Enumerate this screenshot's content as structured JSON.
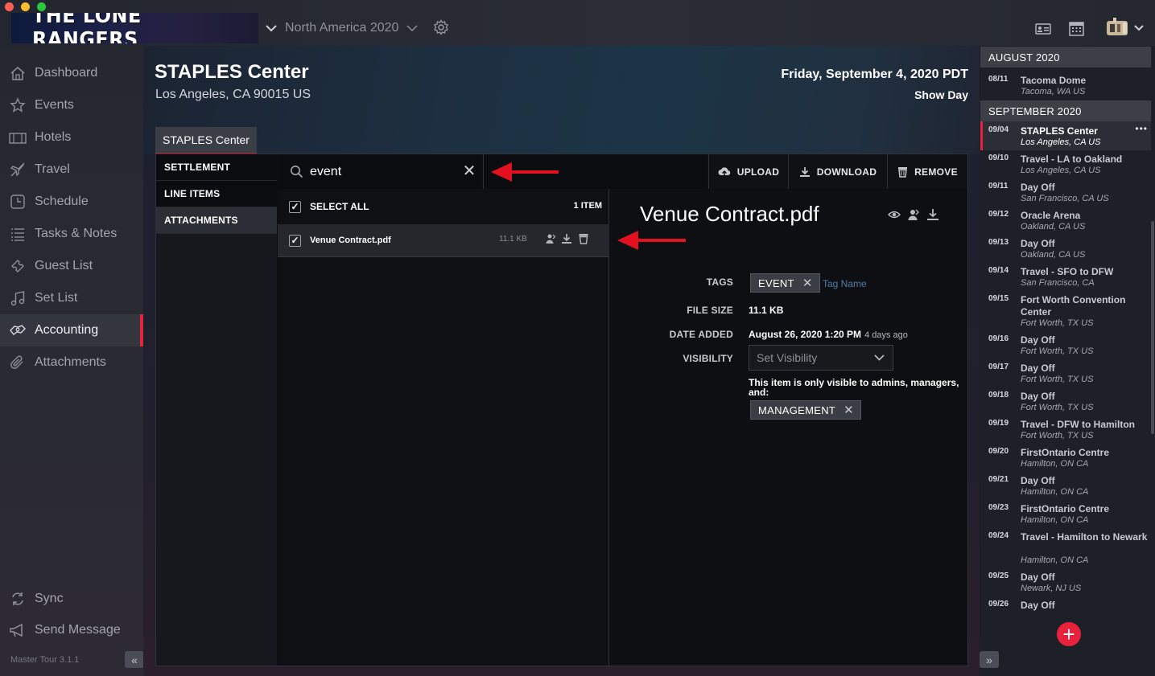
{
  "window": {
    "traffic_colors": [
      "#fe5f57",
      "#febc2e",
      "#28c840"
    ]
  },
  "header": {
    "logo_text": "THE LONE RANGERS",
    "tour_name": "North America 2020"
  },
  "sidebar": {
    "items": [
      {
        "label": "Dashboard",
        "icon": "house-icon"
      },
      {
        "label": "Events",
        "icon": "star-icon"
      },
      {
        "label": "Hotels",
        "icon": "hotel-icon"
      },
      {
        "label": "Travel",
        "icon": "plane-icon"
      },
      {
        "label": "Schedule",
        "icon": "clock-icon"
      },
      {
        "label": "Tasks & Notes",
        "icon": "list-icon"
      },
      {
        "label": "Guest List",
        "icon": "ticket-icon"
      },
      {
        "label": "Set List",
        "icon": "music-note-icon"
      },
      {
        "label": "Accounting",
        "icon": "money-icon",
        "active": true
      },
      {
        "label": "Attachments",
        "icon": "paperclip-icon"
      }
    ],
    "sync_label": "Sync",
    "send_message_label": "Send Message",
    "version": "Master Tour 3.1.1"
  },
  "venue": {
    "name": "STAPLES Center",
    "address": "Los Angeles, CA 90015 US",
    "date": "Friday, September 4, 2020 PDT",
    "day_type": "Show Day",
    "tab_label": "STAPLES Center"
  },
  "subnav": {
    "items": [
      "SETTLEMENT",
      "LINE ITEMS",
      "ATTACHMENTS"
    ],
    "active": "ATTACHMENTS"
  },
  "search": {
    "value": "event"
  },
  "toolbar": {
    "upload_label": "UPLOAD",
    "download_label": "DOWNLOAD",
    "remove_label": "REMOVE"
  },
  "file_list": {
    "select_all_label": "SELECT ALL",
    "count_label": "1 ITEM",
    "files": [
      {
        "name": "Venue Contract.pdf",
        "size": "11.1 KB",
        "checked": true
      }
    ]
  },
  "detail": {
    "title": "Venue Contract.pdf",
    "tags_label": "TAGS",
    "tags": [
      "EVENT"
    ],
    "tag_placeholder": "Tag Name",
    "file_size_label": "FILE SIZE",
    "file_size": "11.1 KB",
    "date_added_label": "DATE ADDED",
    "date_added": "August 26, 2020 1:20 PM",
    "date_added_relative": "4 days ago",
    "visibility_label": "VISIBILITY",
    "visibility_placeholder": "Set Visibility",
    "visibility_note": "This item is only visible to admins, managers, and:",
    "visibility_groups": [
      "MANAGEMENT"
    ]
  },
  "schedule": {
    "months": [
      {
        "label": "AUGUST 2020",
        "items": [
          {
            "date": "08/11",
            "title": "Tacoma Dome",
            "sub": "Tacoma, WA US"
          }
        ]
      },
      {
        "label": "SEPTEMBER 2020",
        "items": [
          {
            "date": "09/04",
            "title": "STAPLES Center",
            "sub": "Los Angeles, CA US",
            "active": true
          },
          {
            "date": "09/10",
            "title": "Travel - LA to Oakland",
            "sub": "Los Angeles, CA US"
          },
          {
            "date": "09/11",
            "title": "Day Off",
            "sub": "San Francisco, CA US"
          },
          {
            "date": "09/12",
            "title": "Oracle Arena",
            "sub": "Oakland, CA US"
          },
          {
            "date": "09/13",
            "title": "Day Off",
            "sub": "Oakland, CA US"
          },
          {
            "date": "09/14",
            "title": "Travel - SFO to DFW",
            "sub": "San Francisco, CA"
          },
          {
            "date": "09/15",
            "title": "Fort Worth Convention Center",
            "sub": "Fort Worth, TX US"
          },
          {
            "date": "09/16",
            "title": "Day Off",
            "sub": "Fort Worth, TX US"
          },
          {
            "date": "09/17",
            "title": "Day Off",
            "sub": "Fort Worth, TX US"
          },
          {
            "date": "09/18",
            "title": "Day Off",
            "sub": "Fort Worth, TX US"
          },
          {
            "date": "09/19",
            "title": "Travel - DFW to Hamilton",
            "sub": "Fort Worth, TX US"
          },
          {
            "date": "09/20",
            "title": "FirstOntario Centre",
            "sub": "Hamilton, ON CA"
          },
          {
            "date": "09/21",
            "title": "Day Off",
            "sub": "Hamilton, ON CA"
          },
          {
            "date": "09/23",
            "title": "FirstOntario Centre",
            "sub": "Hamilton, ON CA"
          },
          {
            "date": "09/24",
            "title": "Travel - Hamilton to Newark",
            "sub": "Hamilton, ON CA"
          },
          {
            "date": "09/25",
            "title": "Day Off",
            "sub": "Newark, NJ US"
          },
          {
            "date": "09/26",
            "title": "Day Off",
            "sub": ""
          }
        ]
      }
    ],
    "more_label": "•••"
  },
  "colors": {
    "accent": "#e8213d",
    "annotation_arrow": "#e3101f"
  }
}
